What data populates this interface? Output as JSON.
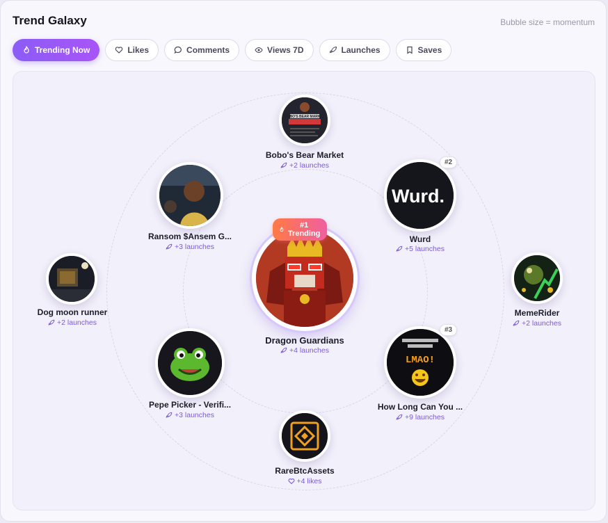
{
  "header": {
    "title": "Trend Galaxy",
    "hint": "Bubble size = momentum"
  },
  "tabs": [
    {
      "label": "Trending Now",
      "icon": "flame-icon",
      "active": true
    },
    {
      "label": "Likes",
      "icon": "heart-icon"
    },
    {
      "label": "Comments",
      "icon": "comment-icon"
    },
    {
      "label": "Views 7D",
      "icon": "eye-icon"
    },
    {
      "label": "Launches",
      "icon": "rocket-icon"
    },
    {
      "label": "Saves",
      "icon": "bookmark-icon"
    }
  ],
  "center": {
    "badge": "#1 Trending",
    "name": "Dragon Guardians",
    "stat": "+4 launches"
  },
  "items": [
    {
      "name": "Bobo's Bear Market",
      "stat": "+2 launches",
      "art_text": "BOBO'S BEAR MARKET"
    },
    {
      "name": "Wurd",
      "stat": "+5 launches",
      "rank": "#2",
      "art_text": "Wurd."
    },
    {
      "name": "Ransom $Ansem G...",
      "stat": "+3 launches"
    },
    {
      "name": "Dog moon runner",
      "stat": "+2 launches"
    },
    {
      "name": "MemeRider",
      "stat": "+2 launches"
    },
    {
      "name": "Pepe Picker - Verifi...",
      "stat": "+3 launches"
    },
    {
      "name": "How Long Can You ...",
      "stat": "+9 launches",
      "rank": "#3",
      "art_text": "LMAO!"
    },
    {
      "name": "RareBtcAssets",
      "stat": "+4 likes"
    }
  ]
}
